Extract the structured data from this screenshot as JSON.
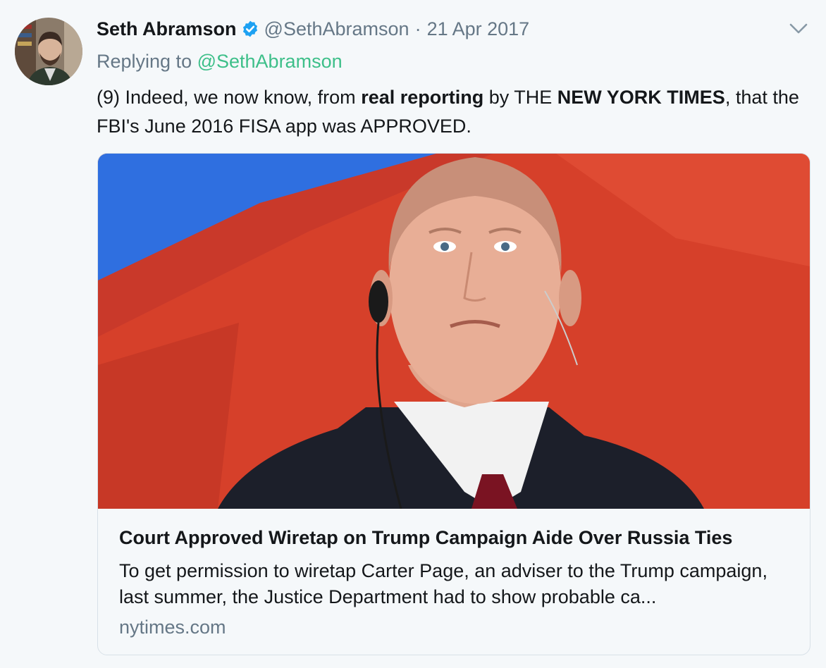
{
  "tweet": {
    "author_name": "Seth Abramson",
    "handle": "@SethAbramson",
    "separator": "·",
    "date": "21 Apr 2017",
    "replying_label": "Replying to ",
    "replying_to": "@SethAbramson",
    "text_parts": {
      "p1": "(9) Indeed, we now know, from ",
      "bold1": "real reporting",
      "p2": " by THE ",
      "bold2": "NEW YORK TIMES",
      "p3": ", that the FBI's June 2016 FISA app was APPROVED."
    }
  },
  "card": {
    "title": "Court Approved Wiretap on Trump Campaign Aide Over Russia Ties",
    "description": "To get permission to wiretap Carter Page, an adviser to the Trump campaign, last summer, the Justice Department had to show probable ca...",
    "domain": "nytimes.com"
  },
  "icons": {
    "verified": "verified-badge-icon",
    "caret": "chevron-down-icon"
  },
  "colors": {
    "link": "#3dbf89",
    "secondary": "#657786",
    "verified": "#1da1f2",
    "background": "#f5f8fa"
  }
}
